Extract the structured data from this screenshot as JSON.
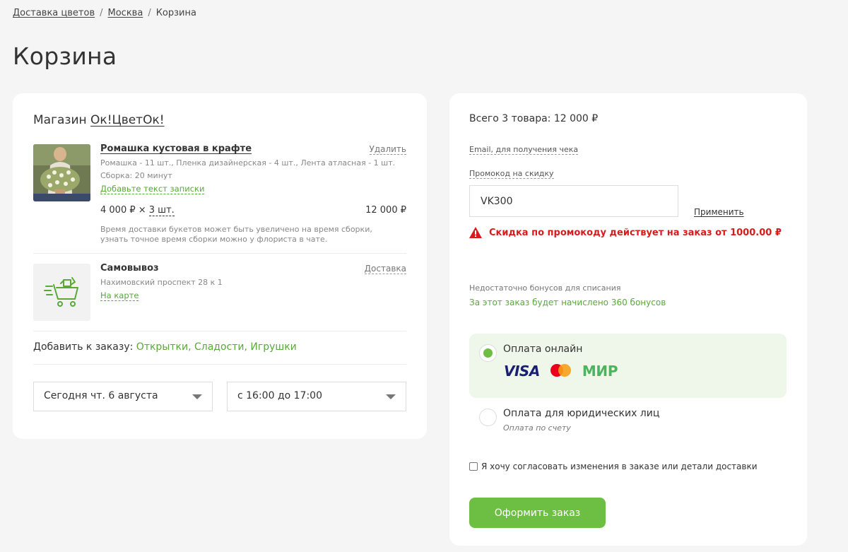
{
  "breadcrumb": {
    "items": [
      "Доставка цветов",
      "Москва"
    ],
    "separator": "/",
    "current": "Корзина"
  },
  "page_title": "Корзина",
  "shop": {
    "prefix": "Магазин ",
    "name": "Ок!ЦветОк!"
  },
  "product": {
    "name": "Ромашка кустовая в крафте",
    "remove_label": "Удалить",
    "composition": "Ромашка - 11 шт., Пленка дизайнерская - 4 шт., Лента атласная - 1 шт.",
    "assembly": "Сборка: 20 минут",
    "note_link": "Добавьте текст записки",
    "price": "4 000 ₽ × ",
    "qty": "3 шт.",
    "total": "12 000 ₽",
    "info": "Время доставки букетов может быть увеличено на время сборки, узнать точное время сборки можно у флориста в чате."
  },
  "pickup": {
    "name": "Самовывоз",
    "switch_label": "Доставка",
    "address": "Нахимовский проспект 28 к 1",
    "map_link": "На карте"
  },
  "addons": {
    "label": "Добавить к заказу: ",
    "items": [
      "Открытки",
      "Сладости",
      "Игрушки"
    ],
    "sep": ", "
  },
  "date_select": {
    "value": "Сегодня чт. 6 августа"
  },
  "time_select": {
    "value": "с 16:00 до 17:00"
  },
  "summary": {
    "total": "Всего 3 товара: 12 000 ₽",
    "email_label": "Email, для получения чека",
    "promo_label": "Промокод на скидку",
    "promo_value": "VK300",
    "apply_label": "Применить",
    "promo_error": "Скидка по промокоду действует на заказ от 1000.00 ₽",
    "bonus_warning": "Недостаточно бонусов для списания",
    "bonus_earn": "За этот заказ будет начислено 360 бонусов"
  },
  "payment": {
    "online_label": "Оплата онлайн",
    "online_selected": true,
    "logos": {
      "visa": "VISA",
      "mir": "МИР"
    },
    "legal_label": "Оплата для юридических лиц",
    "legal_sub": "Оплата по счету",
    "legal_selected": false
  },
  "agreement": {
    "label": "Я хочу согласовать изменения в заказе или детали доставки",
    "checked": false
  },
  "order_button": "Оформить заказ",
  "colors": {
    "accent": "#6cbf42",
    "error": "#d81b1b",
    "link_green": "#5aa83a"
  }
}
